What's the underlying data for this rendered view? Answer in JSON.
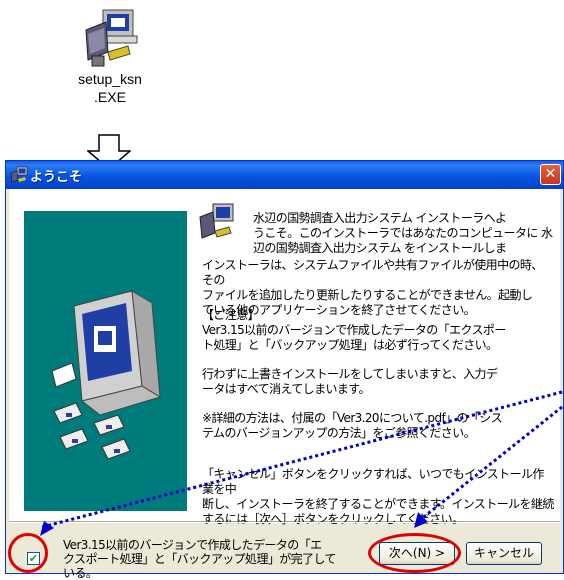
{
  "desktop_icon": {
    "name_line1": "setup_ksn",
    "name_line2": ".EXE"
  },
  "dialog": {
    "title": "ようこそ",
    "close_glyph": "✕",
    "intro": [
      "水辺の国勢調査入出力システム インストーラへよ",
      "うこそ。このインストーラではあなたのコンピュータに 水",
      "辺の国勢調査入出力システム をインストールしま"
    ],
    "installer_note": [
      "インストーラは、システムファイルや共有ファイルが使用中の時、その",
      "ファイルを追加したり更新したりすることができません。起動し",
      "ている他のアプリケーションを終了させてください。"
    ],
    "caution_heading": "【ご注意】",
    "caution_body": [
      "Ver3.15以前のバージョンで作成したデータの「エクスポー",
      "ト処理」と「バックアップ処理」は必ず行ってください。"
    ],
    "overwrite_warning": [
      "行わずに上書きインストールをしてしまいますと、入力デ",
      "ータはすべて消えてしまいます。"
    ],
    "details_note": [
      "※詳細の方法は、付属の「Ver3.20について.pdf」の「シス",
      "テムのバージョンアップの方法」をご参照ください。"
    ],
    "cancel_note": [
      "「キャンセル」ボタンをクリックすれば、いつでもインストール作業を中",
      "断し、インストーラを終了することができます。インストールを継続",
      "するには［次へ］ボタンをクリックしてください。"
    ],
    "checkbox_label": [
      "Ver3.15以前のバージョンで作成したデータの「エ",
      "クスポート処理」と「バックアップ処理」が完了して",
      "いる。"
    ],
    "checkbox_mark": "✔",
    "next_button": "次へ(N) >",
    "cancel_button": "キャンセル"
  },
  "colors": {
    "annotation_red": "#e00000",
    "annotation_blue": "#0000cc",
    "side_panel": "#007b7b",
    "title_blue": "#0554e3"
  }
}
